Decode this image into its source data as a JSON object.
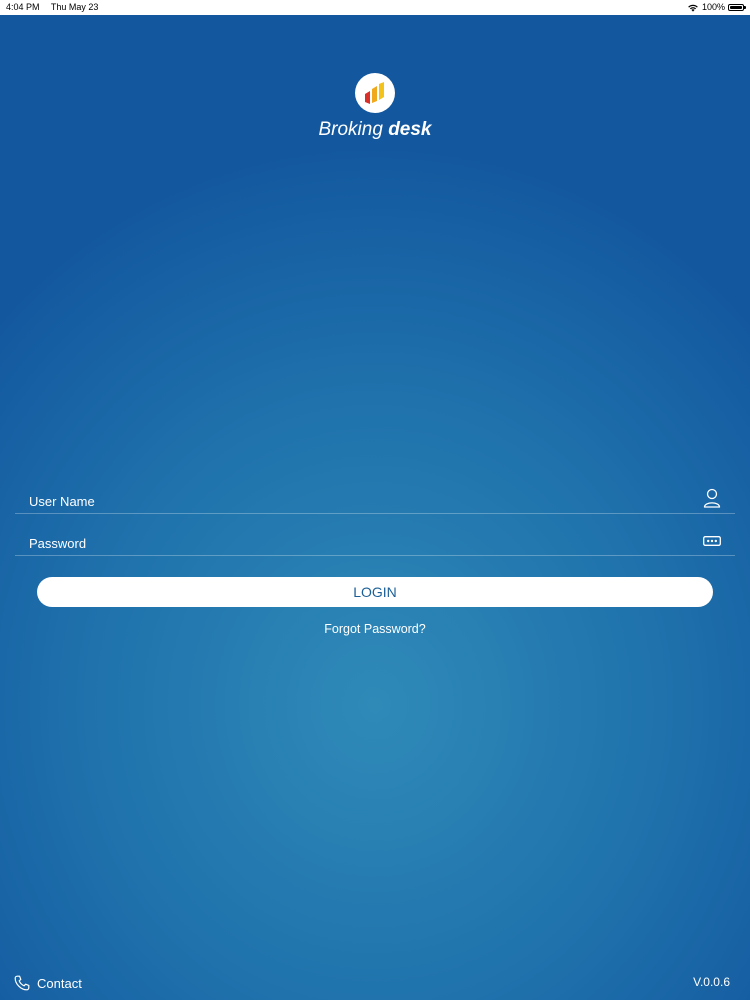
{
  "status_bar": {
    "time": "4:04 PM",
    "date": "Thu May 23",
    "battery": "100%",
    "wifi_icon": "wifi-icon",
    "battery_icon": "battery-icon"
  },
  "brand": {
    "logo_icon": "brokingdesk-logo",
    "name_light": "Broking ",
    "name_bold": "desk"
  },
  "login_form": {
    "username": {
      "placeholder": "User Name",
      "value": "",
      "icon": "user-icon"
    },
    "password": {
      "placeholder": "Password",
      "value": "",
      "icon": "password-dots-icon"
    },
    "login_label": "LOGIN",
    "forgot_label": "Forgot Password?"
  },
  "footer": {
    "contact_label": "Contact",
    "contact_icon": "phone-icon",
    "version": "V.0.0.6"
  },
  "colors": {
    "background_top": "#13589f",
    "background_center": "#2f8ab8",
    "button_background": "#ffffff",
    "button_text": "#1c5f97",
    "logo_bars": [
      "#d9302a",
      "#f0a81c",
      "#f3c21b"
    ]
  }
}
